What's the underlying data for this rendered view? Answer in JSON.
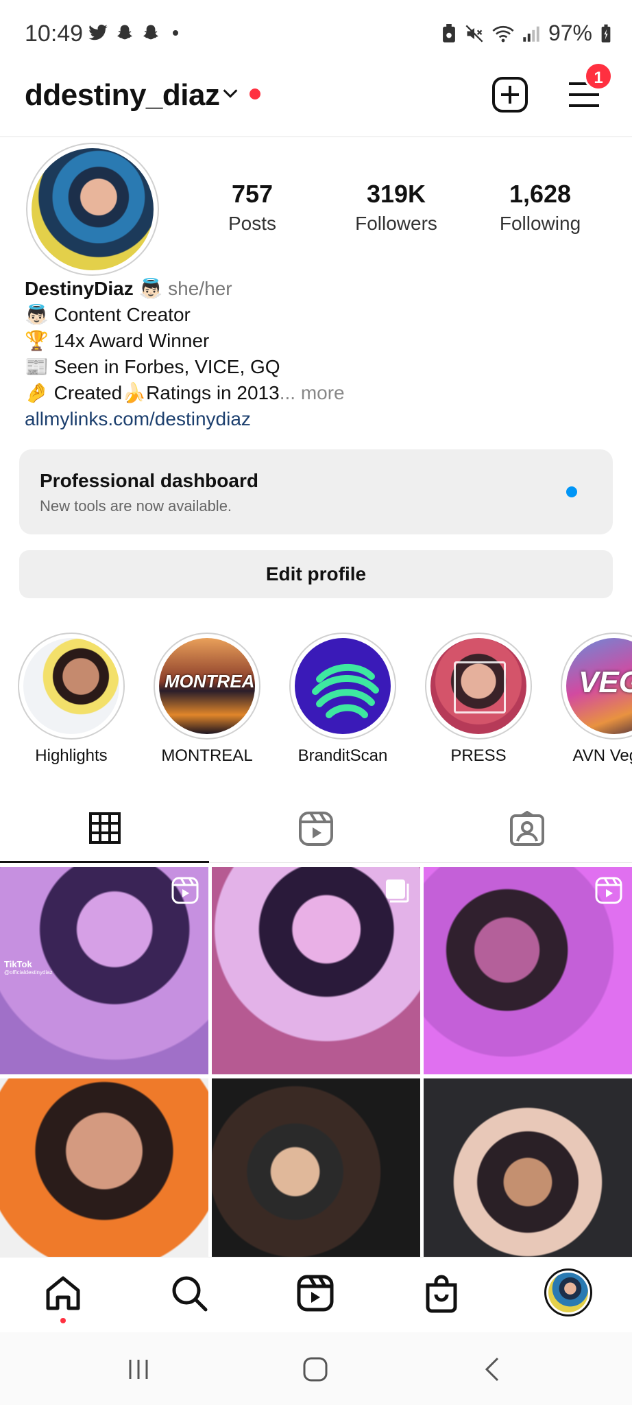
{
  "status_bar": {
    "time": "10:49",
    "battery": "97%",
    "left_icons": [
      "twitter-icon",
      "snapchat-icon",
      "snapchat-icon",
      "dot-icon"
    ],
    "right_icons": [
      "nfc-icon",
      "mute-icon",
      "wifi-icon",
      "signal-icon",
      "battery-icon"
    ]
  },
  "header": {
    "username": "ddestiny_diaz",
    "notification_count": "1"
  },
  "stats": [
    {
      "value": "757",
      "label": "Posts"
    },
    {
      "value": "319K",
      "label": "Followers"
    },
    {
      "value": "1,628",
      "label": "Following"
    }
  ],
  "bio": {
    "name": "DestinyDiaz",
    "pronouns": "she/her",
    "lines": [
      "👼🏻 Content Creator",
      "🏆 14x Award Winner",
      "📰 Seen in Forbes, VICE, GQ",
      "🤌 Created🍌Ratings in 2013"
    ],
    "more": "... more",
    "link": "allmylinks.com/destinydiaz"
  },
  "dashboard": {
    "title": "Professional dashboard",
    "subtitle": "New tools are now available."
  },
  "edit_profile_label": "Edit profile",
  "highlights": [
    {
      "label": "Highlights"
    },
    {
      "label": "MONTREAL",
      "overlay": "MONTREAL"
    },
    {
      "label": "BranditScan"
    },
    {
      "label": "PRESS"
    },
    {
      "label": "AVN Vegas",
      "overlay": "VEGA"
    }
  ],
  "tabs": [
    "grid-icon",
    "reels-icon",
    "tagged-icon"
  ],
  "posts": [
    {
      "type": "reel",
      "overlay": "TikTok",
      "handle": "@officialdestinydiaz"
    },
    {
      "type": "carousel"
    },
    {
      "type": "reel"
    },
    {
      "type": "photo"
    },
    {
      "type": "photo"
    },
    {
      "type": "photo"
    }
  ],
  "bottom_nav": [
    "home-icon",
    "search-icon",
    "reels-icon",
    "shop-icon",
    "profile-avatar"
  ],
  "colors": {
    "accent_red": "#ff3040",
    "accent_blue": "#0095f6",
    "link": "#1c3f6e"
  }
}
